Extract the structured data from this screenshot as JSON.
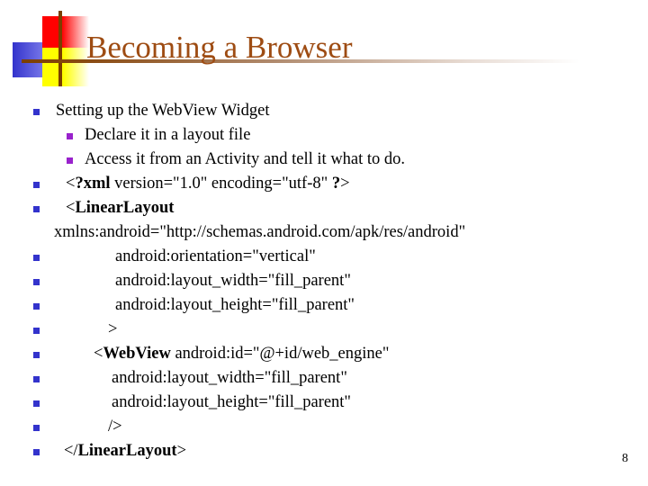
{
  "slide": {
    "title": "Becoming a Browser",
    "page_number": "8",
    "colors": {
      "title": "#9e4c13",
      "rule": "#7b3f00",
      "bullet_level1": "#3333cc",
      "bullet_level2": "#9922cc",
      "logo_red": "#ff0000",
      "logo_blue": "#3333cc",
      "logo_yellow": "#ffff00",
      "logo_cross": "#7b3f00",
      "body_text": "#000000",
      "background": "#ffffff"
    }
  },
  "body": {
    "lines": [
      {
        "id": "setting-up",
        "bullet": "level1",
        "indent": "i-a",
        "segments": [
          {
            "text": "Setting up the Web",
            "bold": false
          },
          {
            "text": "View Widget",
            "bold": false
          }
        ],
        "text": "Setting up the WebView Widget"
      },
      {
        "id": "declare-layout",
        "bullet": "level2",
        "indent": "i-b",
        "text": "Declare it in a layout file"
      },
      {
        "id": "access-activity",
        "bullet": "level2",
        "indent": "i-b",
        "text": "Access it from an Activity and tell it what to do."
      },
      {
        "id": "xml-decl",
        "bullet": "level1",
        "indent": "i-c",
        "prefix_open": "<",
        "bold_token": "?xml",
        "suffix": "  version=\"1.0\" encoding=\"utf-8\" ",
        "bold_tail": "?",
        "close": ">",
        "text": "<?xml  version=\"1.0\" encoding=\"utf-8\" ?>"
      },
      {
        "id": "linearlayout-open",
        "bullet": "level1",
        "indent": "i-d",
        "prefix_open": "<",
        "bold_token": "LinearLayout",
        "text": "<LinearLayout"
      },
      {
        "id": "xmlns-android",
        "bullet": "none",
        "indent": "i-e",
        "text": "xmlns:android=\"http://schemas.android.com/apk/res/android\""
      },
      {
        "id": "android-orientation",
        "bullet": "level1",
        "indent": "i-f",
        "text": "android:orientation=\"vertical\""
      },
      {
        "id": "ll-layout-width",
        "bullet": "level1",
        "indent": "i-f",
        "text": "android:layout_width=\"fill_parent\""
      },
      {
        "id": "ll-layout-height",
        "bullet": "level1",
        "indent": "i-f",
        "text": "android:layout_height=\"fill_parent\""
      },
      {
        "id": "ll-close-bracket",
        "bullet": "level1",
        "indent": "i-g",
        "text": ">"
      },
      {
        "id": "webview-open",
        "bullet": "level1",
        "indent": "i-h",
        "prefix_open": "<",
        "bold_token": "WebView",
        "suffix": "  android:id=\"@+id/web_engine\"",
        "text": "<WebView  android:id=\"@+id/web_engine\""
      },
      {
        "id": "wv-layout-width",
        "bullet": "level1",
        "indent": "i-i",
        "text": "android:layout_width=\"fill_parent\""
      },
      {
        "id": "wv-layout-height",
        "bullet": "level1",
        "indent": "i-i",
        "text": "android:layout_height=\"fill_parent\""
      },
      {
        "id": "wv-self-close",
        "bullet": "level1",
        "indent": "i-j",
        "text": "/>"
      },
      {
        "id": "linearlayout-close",
        "bullet": "level1",
        "indent": "i-k",
        "prefix_open": "</",
        "bold_token": "LinearLayout",
        "close": ">",
        "text": "</LinearLayout>"
      }
    ]
  }
}
